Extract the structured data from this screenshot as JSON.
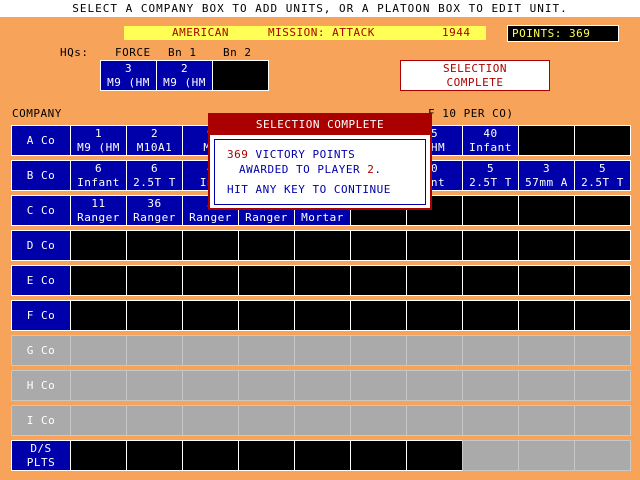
{
  "header": {
    "instruction": "SELECT A COMPANY BOX TO ADD UNITS, OR A PLATOON BOX TO EDIT UNIT.",
    "side": "AMERICAN",
    "mission": "MISSION: ATTACK",
    "year": "1944",
    "points_label": "POINTS:",
    "points_value": "369"
  },
  "hqs": {
    "label": "HQs:",
    "columns": [
      "FORCE",
      "Bn 1",
      "Bn 2"
    ],
    "boxes": [
      {
        "num": "3",
        "type": "M9 (HM"
      },
      {
        "num": "2",
        "type": "M9 (HM"
      },
      {
        "num": "",
        "type": ""
      }
    ]
  },
  "selection_box": {
    "line1": "SELECTION",
    "line2": "COMPLETE"
  },
  "company_header": "COMPANY",
  "company_header_suffix": "F 10 PER CO)",
  "rows": [
    {
      "label": "A Co",
      "style": "blue",
      "cells": [
        [
          "1",
          "M9 (HM"
        ],
        [
          "2",
          "M10A1"
        ],
        [
          "9",
          "M9"
        ],
        [
          "",
          ""
        ],
        [
          "",
          ""
        ],
        [
          "",
          ""
        ],
        [
          "5",
          "(HM"
        ],
        [
          "40",
          "Infant"
        ],
        [
          "",
          ""
        ],
        [
          "",
          ""
        ]
      ]
    },
    {
      "label": "B Co",
      "style": "blue",
      "cells": [
        [
          "6",
          "Infant"
        ],
        [
          "6",
          "2.5T T"
        ],
        [
          "4",
          "Inf"
        ],
        [
          "",
          ""
        ],
        [
          "",
          ""
        ],
        [
          "",
          ""
        ],
        [
          "0",
          "ant"
        ],
        [
          "5",
          "2.5T T"
        ],
        [
          "3",
          "57mm A"
        ],
        [
          "5",
          "2.5T T"
        ]
      ]
    },
    {
      "label": "C Co",
      "style": "blue",
      "cells": [
        [
          "11",
          "Ranger"
        ],
        [
          "36",
          "Ranger"
        ],
        [
          "3",
          "Ranger"
        ],
        [
          "",
          "Ranger"
        ],
        [
          "",
          "Mortar"
        ],
        [
          "",
          ""
        ],
        [
          "",
          ""
        ],
        [
          "",
          ""
        ],
        [
          "",
          ""
        ],
        [
          "",
          ""
        ]
      ]
    },
    {
      "label": "D Co",
      "style": "blue",
      "cells": [
        [
          "",
          ""
        ],
        [
          "",
          ""
        ],
        [
          "",
          ""
        ],
        [
          "",
          ""
        ],
        [
          "",
          ""
        ],
        [
          "",
          ""
        ],
        [
          "",
          ""
        ],
        [
          "",
          ""
        ],
        [
          "",
          ""
        ],
        [
          "",
          ""
        ]
      ]
    },
    {
      "label": "E Co",
      "style": "blue",
      "cells": [
        [
          "",
          ""
        ],
        [
          "",
          ""
        ],
        [
          "",
          ""
        ],
        [
          "",
          ""
        ],
        [
          "",
          ""
        ],
        [
          "",
          ""
        ],
        [
          "",
          ""
        ],
        [
          "",
          ""
        ],
        [
          "",
          ""
        ],
        [
          "",
          ""
        ]
      ]
    },
    {
      "label": "F Co",
      "style": "blue",
      "cells": [
        [
          "",
          ""
        ],
        [
          "",
          ""
        ],
        [
          "",
          ""
        ],
        [
          "",
          ""
        ],
        [
          "",
          ""
        ],
        [
          "",
          ""
        ],
        [
          "",
          ""
        ],
        [
          "",
          ""
        ],
        [
          "",
          ""
        ],
        [
          "",
          ""
        ]
      ]
    },
    {
      "label": "G Co",
      "style": "gray",
      "cells": [
        [
          "",
          ""
        ],
        [
          "",
          ""
        ],
        [
          "",
          ""
        ],
        [
          "",
          ""
        ],
        [
          "",
          ""
        ],
        [
          "",
          ""
        ],
        [
          "",
          ""
        ],
        [
          "",
          ""
        ],
        [
          "",
          ""
        ],
        [
          "",
          ""
        ]
      ]
    },
    {
      "label": "H Co",
      "style": "gray",
      "cells": [
        [
          "",
          ""
        ],
        [
          "",
          ""
        ],
        [
          "",
          ""
        ],
        [
          "",
          ""
        ],
        [
          "",
          ""
        ],
        [
          "",
          ""
        ],
        [
          "",
          ""
        ],
        [
          "",
          ""
        ],
        [
          "",
          ""
        ],
        [
          "",
          ""
        ]
      ]
    },
    {
      "label": "I Co",
      "style": "gray",
      "cells": [
        [
          "",
          ""
        ],
        [
          "",
          ""
        ],
        [
          "",
          ""
        ],
        [
          "",
          ""
        ],
        [
          "",
          ""
        ],
        [
          "",
          ""
        ],
        [
          "",
          ""
        ],
        [
          "",
          ""
        ],
        [
          "",
          ""
        ],
        [
          "",
          ""
        ]
      ]
    },
    {
      "label": "D/S",
      "label2": "PLTS",
      "style": "blue",
      "cells": [
        [
          "",
          ""
        ],
        [
          "",
          ""
        ],
        [
          "",
          ""
        ],
        [
          "",
          ""
        ],
        [
          "",
          ""
        ],
        [
          "",
          ""
        ],
        [
          "",
          ""
        ],
        [
          "",
          ""
        ],
        [
          "",
          ""
        ],
        [
          "",
          ""
        ]
      ]
    }
  ],
  "cell_styles": [
    [
      "blue",
      "blue",
      "blue",
      "blue",
      "blue",
      "blue",
      "blue",
      "blue",
      "black",
      "black"
    ],
    [
      "blue",
      "blue",
      "blue",
      "blue",
      "blue",
      "blue",
      "blue",
      "blue",
      "blue",
      "blue"
    ],
    [
      "blue",
      "blue",
      "blue",
      "blue",
      "blue",
      "black",
      "black",
      "black",
      "black",
      "black"
    ],
    [
      "black",
      "black",
      "black",
      "black",
      "black",
      "black",
      "black",
      "black",
      "black",
      "black"
    ],
    [
      "black",
      "black",
      "black",
      "black",
      "black",
      "black",
      "black",
      "black",
      "black",
      "black"
    ],
    [
      "black",
      "black",
      "black",
      "black",
      "black",
      "black",
      "black",
      "black",
      "black",
      "black"
    ],
    [
      "gray",
      "gray",
      "gray",
      "gray",
      "gray",
      "gray",
      "gray",
      "gray",
      "gray",
      "gray"
    ],
    [
      "gray",
      "gray",
      "gray",
      "gray",
      "gray",
      "gray",
      "gray",
      "gray",
      "gray",
      "gray"
    ],
    [
      "gray",
      "gray",
      "gray",
      "gray",
      "gray",
      "gray",
      "gray",
      "gray",
      "gray",
      "gray"
    ],
    [
      "black",
      "black",
      "black",
      "black",
      "black",
      "black",
      "black",
      "gray",
      "gray",
      "gray"
    ]
  ],
  "dialog": {
    "title": "SELECTION COMPLETE",
    "points": "369",
    "line1_rest": " VICTORY POINTS",
    "line2_pre": "AWARDED TO PLAYER ",
    "player": "2",
    "line2_post": ".",
    "line3": "HIT ANY KEY TO CONTINUE"
  },
  "colors": {
    "background": "#f7a45a",
    "blue": "#0000aa",
    "red": "#aa0000",
    "yellow": "#ffff55",
    "gray": "#aaaaaa"
  }
}
